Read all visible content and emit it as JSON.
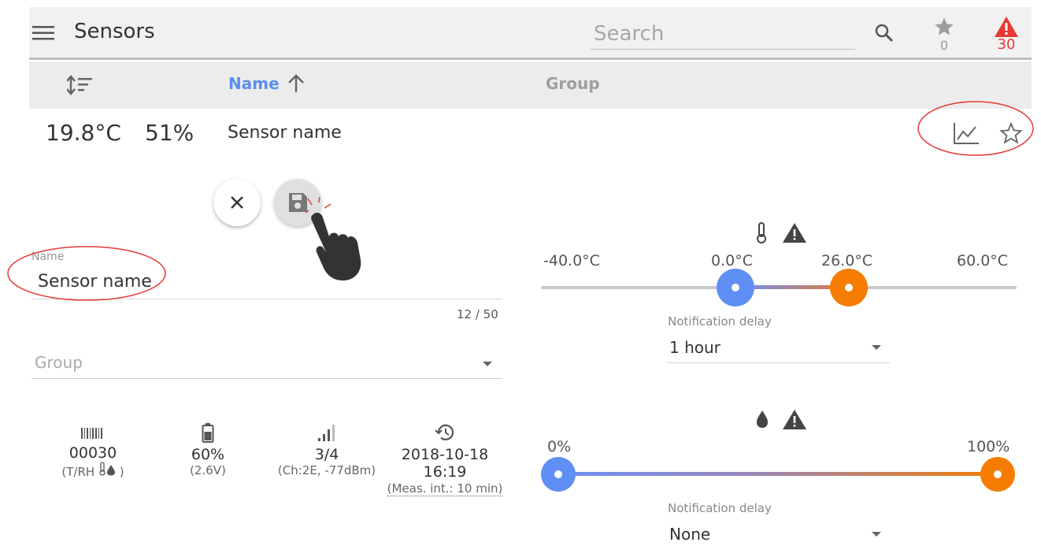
{
  "colors": {
    "accent": "#5b8def",
    "alert": "#e53935",
    "low_thumb": "#5f8ef5",
    "high_thumb": "#f57c00",
    "annotation": "#e53935"
  },
  "header": {
    "title": "Sensors",
    "search_placeholder": "Search",
    "favorites_count": "0",
    "alerts_count": "30",
    "icons": [
      "menu-icon",
      "search-icon",
      "star-icon",
      "alert-icon"
    ]
  },
  "table": {
    "columns": [
      "Name",
      "Group"
    ],
    "sorted_by": "Name"
  },
  "sensor": {
    "temperature": "19.8°C",
    "humidity": "51%",
    "name": "Sensor name"
  },
  "form": {
    "name_label": "Name",
    "name_value": "Sensor name",
    "name_counter": "12 / 50",
    "group_placeholder": "Group"
  },
  "info": {
    "id": "00030",
    "type": "(T/RH",
    "type_close": ")",
    "battery": "60%",
    "voltage": "(2.6V)",
    "signal": "3/4",
    "channel": "(Ch:2E, -77dBm)",
    "date": "2018-10-18",
    "time": "16:19",
    "interval": "(Meas. int.: 10 min)"
  },
  "temperature_alarm": {
    "min_label": "-40.0°C",
    "low_label": "0.0°C",
    "high_label": "26.0°C",
    "max_label": "60.0°C",
    "delay_label": "Notification delay",
    "delay_value": "1 hour"
  },
  "humidity_alarm": {
    "min_label": "0%",
    "max_label": "100%",
    "delay_label": "Notification delay",
    "delay_value": "None"
  }
}
